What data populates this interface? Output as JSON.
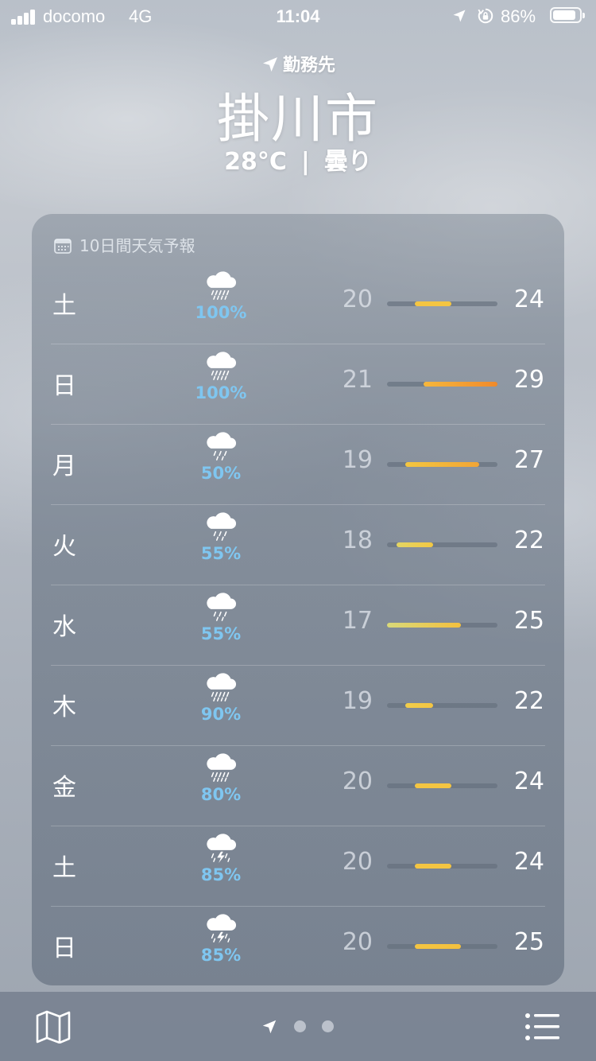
{
  "status_bar": {
    "carrier": "docomo",
    "network": "4G",
    "time": "11:04",
    "battery": "86%",
    "battery_level": 0.86
  },
  "header": {
    "location_label": "勤務先",
    "city": "掛川市",
    "temperature": "28°C",
    "separator": "|",
    "condition": "曇り"
  },
  "forecast": {
    "title": "10日間天気予報",
    "scale_min": 17,
    "scale_max": 29,
    "days": [
      {
        "day": "土",
        "icon": "heavy-rain-icon",
        "pop": "100%",
        "low": "20",
        "high": "24",
        "low_v": 20,
        "high_v": 24,
        "color_from": "#f4c542",
        "color_to": "#f4c542"
      },
      {
        "day": "日",
        "icon": "heavy-rain-icon",
        "pop": "100%",
        "low": "21",
        "high": "29",
        "low_v": 21,
        "high_v": 29,
        "color_from": "#f6b73c",
        "color_to": "#f08a2c"
      },
      {
        "day": "月",
        "icon": "rain-icon",
        "pop": "50%",
        "low": "19",
        "high": "27",
        "low_v": 19,
        "high_v": 27,
        "color_from": "#f3c640",
        "color_to": "#f2a535"
      },
      {
        "day": "火",
        "icon": "rain-icon",
        "pop": "55%",
        "low": "18",
        "high": "22",
        "low_v": 18,
        "high_v": 22,
        "color_from": "#e3d564",
        "color_to": "#f3c843"
      },
      {
        "day": "水",
        "icon": "rain-icon",
        "pop": "55%",
        "low": "17",
        "high": "25",
        "low_v": 17,
        "high_v": 25,
        "color_from": "#d9d97a",
        "color_to": "#f3c03e"
      },
      {
        "day": "木",
        "icon": "heavy-rain-icon",
        "pop": "90%",
        "low": "19",
        "high": "22",
        "low_v": 19,
        "high_v": 22,
        "color_from": "#f1cd4a",
        "color_to": "#f4c542"
      },
      {
        "day": "金",
        "icon": "heavy-rain-icon",
        "pop": "80%",
        "low": "20",
        "high": "24",
        "low_v": 20,
        "high_v": 24,
        "color_from": "#f4c542",
        "color_to": "#f4c542"
      },
      {
        "day": "土",
        "icon": "thunderstorm-icon",
        "pop": "85%",
        "low": "20",
        "high": "24",
        "low_v": 20,
        "high_v": 24,
        "color_from": "#f4c542",
        "color_to": "#f4c542"
      },
      {
        "day": "日",
        "icon": "thunderstorm-icon",
        "pop": "85%",
        "low": "20",
        "high": "25",
        "low_v": 20,
        "high_v": 25,
        "color_from": "#f4c542",
        "color_to": "#f3c03e"
      }
    ]
  },
  "bottom_bar": {
    "map_icon": "map-icon",
    "list_icon": "list-icon",
    "pages": 3,
    "current_page": 0
  }
}
